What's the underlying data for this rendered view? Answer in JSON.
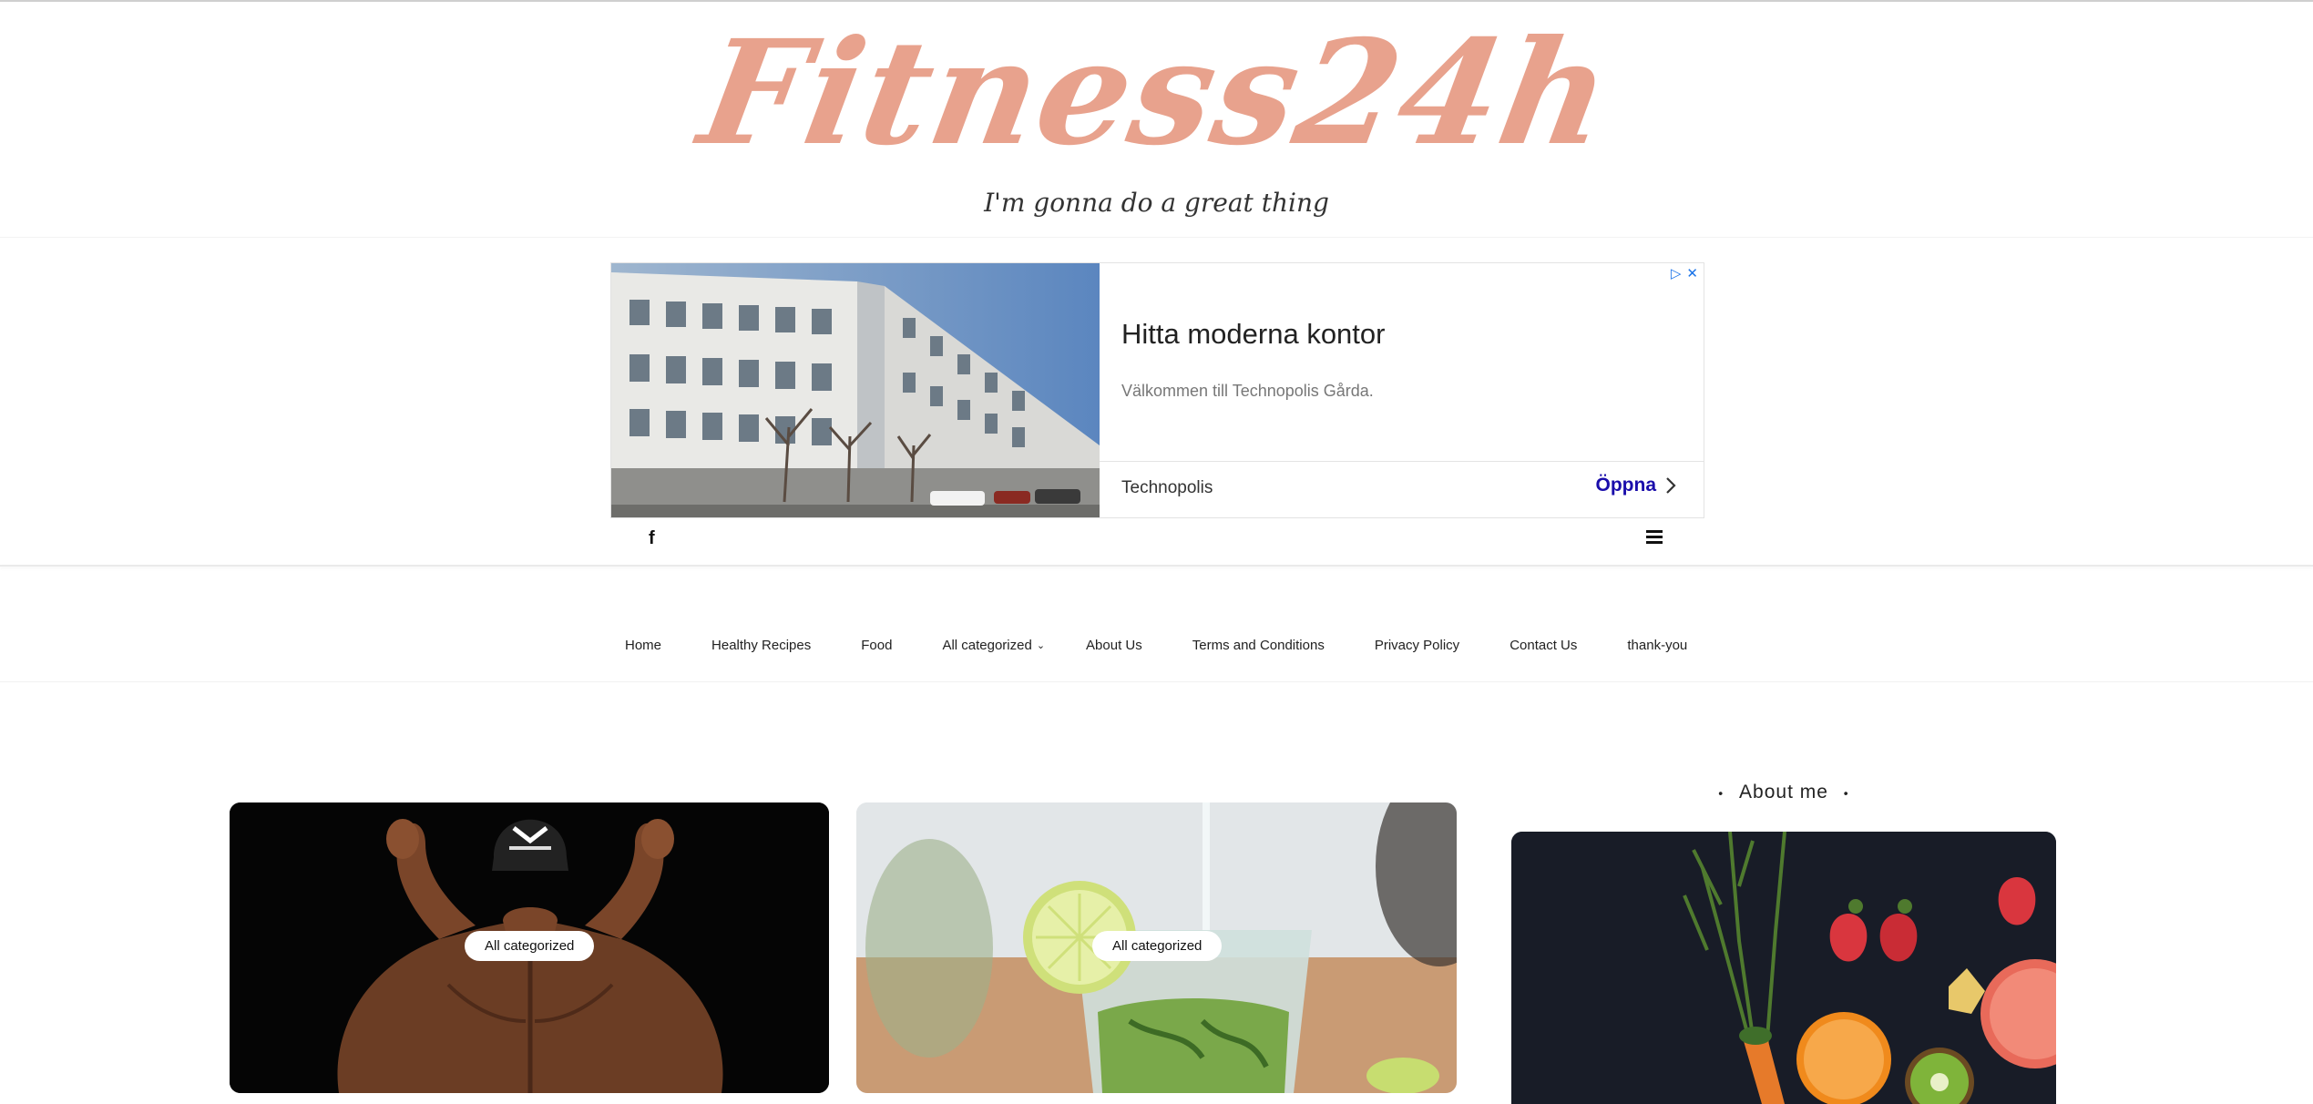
{
  "site": {
    "title": "Fitness24h",
    "tagline": "I'm gonna do a great thing"
  },
  "ad": {
    "headline": "Hitta moderna kontor",
    "description": "Välkommen till Technopolis Gårda.",
    "advertiser": "Technopolis",
    "cta": "Öppna",
    "choices_icons": [
      "adchoices-icon",
      "close-icon"
    ]
  },
  "toolbar": {
    "social": [
      {
        "icon": "facebook-icon",
        "glyph": "f"
      }
    ],
    "menu_icon": "hamburger-menu-icon"
  },
  "nav": {
    "items": [
      {
        "label": "Home"
      },
      {
        "label": "Healthy Recipes"
      },
      {
        "label": "Food"
      },
      {
        "label": "All categorized",
        "has_dropdown": true
      },
      {
        "label": "About Us"
      },
      {
        "label": "Terms and Conditions"
      },
      {
        "label": "Privacy Policy"
      },
      {
        "label": "Contact Us"
      },
      {
        "label": "thank-you"
      }
    ]
  },
  "posts": [
    {
      "category": "All categorized",
      "image": "bodybuilder back flexing in cap"
    },
    {
      "category": "All categorized",
      "image": "glass of mojito with lime and mint"
    }
  ],
  "sidebar": {
    "about_title": "About me",
    "bullet": "•",
    "image": "vegetables and fruits on dark cloth"
  }
}
